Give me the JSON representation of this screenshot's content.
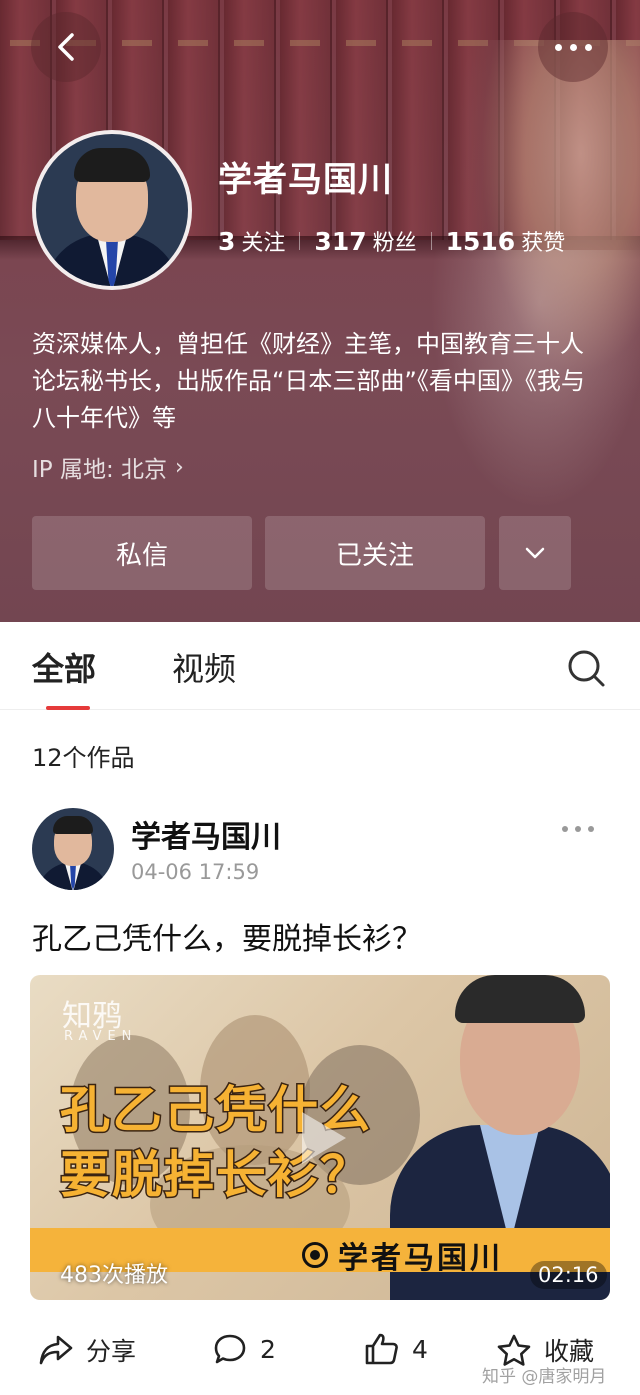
{
  "nav": {
    "back_icon": "chevron-left-icon",
    "more_icon": "more-horizontal-icon"
  },
  "profile": {
    "name": "学者马国川",
    "stats": [
      {
        "value": "3",
        "label": "关注"
      },
      {
        "value": "317",
        "label": "粉丝"
      },
      {
        "value": "1516",
        "label": "获赞"
      }
    ],
    "bio": "资深媒体人，曾担任《财经》主笔，中国教育三十人论坛秘书长，出版作品“日本三部曲”《看中国》《我与八十年代》等",
    "ip_location": "IP 属地: 北京",
    "message_button": "私信",
    "following_button": "已关注",
    "header_color": "#7a4a55"
  },
  "tabs": {
    "all": "全部",
    "video": "视频",
    "active_underline_color": "#e53a3a"
  },
  "works_count": "12个作品",
  "post": {
    "author": "学者马国川",
    "time": "04-06 17:59",
    "title": "孔乙己凭什么，要脱掉长衫？",
    "video": {
      "watermark_cn": "知鸦",
      "watermark_en": "RAVEN",
      "caption_line1": "孔乙己凭什么",
      "caption_line2": "要脱掉长衫？",
      "bar_label": "学者马国川",
      "plays": "483次播放",
      "duration": "02:16",
      "accent_color": "#f5b33b"
    },
    "actions": {
      "share": "分享",
      "comments": "2",
      "likes": "4",
      "favorite": "收藏"
    }
  },
  "site_watermark": "知乎 @唐家明月"
}
